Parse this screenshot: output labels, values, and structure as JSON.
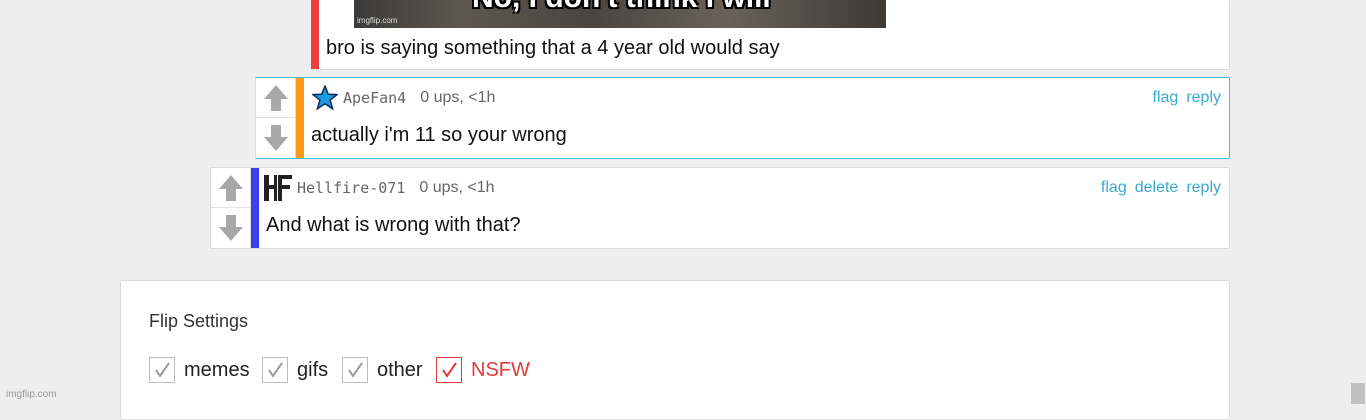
{
  "top_comment": {
    "image_watermark": "imgflip.com",
    "image_caption_partial": "No, I don't think I will",
    "text": "bro is saying something that a 4 year old would say",
    "stripe_color": "#ee3f3f"
  },
  "comments": [
    {
      "username": "ApeFan4",
      "meta": "0 ups, <1h",
      "text": "actually i'm 11 so your wrong",
      "actions": [
        "flag",
        "reply"
      ],
      "stripe_color": "#ff9a1a",
      "avatar_icon": "blue-star-icon",
      "highlighted": true
    },
    {
      "username": "Hellfire-071",
      "meta": "0 ups, <1h",
      "text": "And what is wrong with that?",
      "actions": [
        "flag",
        "delete",
        "reply"
      ],
      "stripe_color": "#3d3df0",
      "avatar_icon": "hf-logo-icon",
      "highlighted": false
    }
  ],
  "flip_settings": {
    "title": "Flip Settings",
    "options": [
      {
        "label": "memes",
        "checked": true
      },
      {
        "label": "gifs",
        "checked": true
      },
      {
        "label": "other",
        "checked": true
      },
      {
        "label": "NSFW",
        "checked": true,
        "accent": "#e03a3a"
      }
    ]
  },
  "page_watermark": "imgflip.com",
  "colors": {
    "link": "#3aaad4",
    "highlight_border": "#3fc0d8",
    "background": "#eeeeee"
  }
}
